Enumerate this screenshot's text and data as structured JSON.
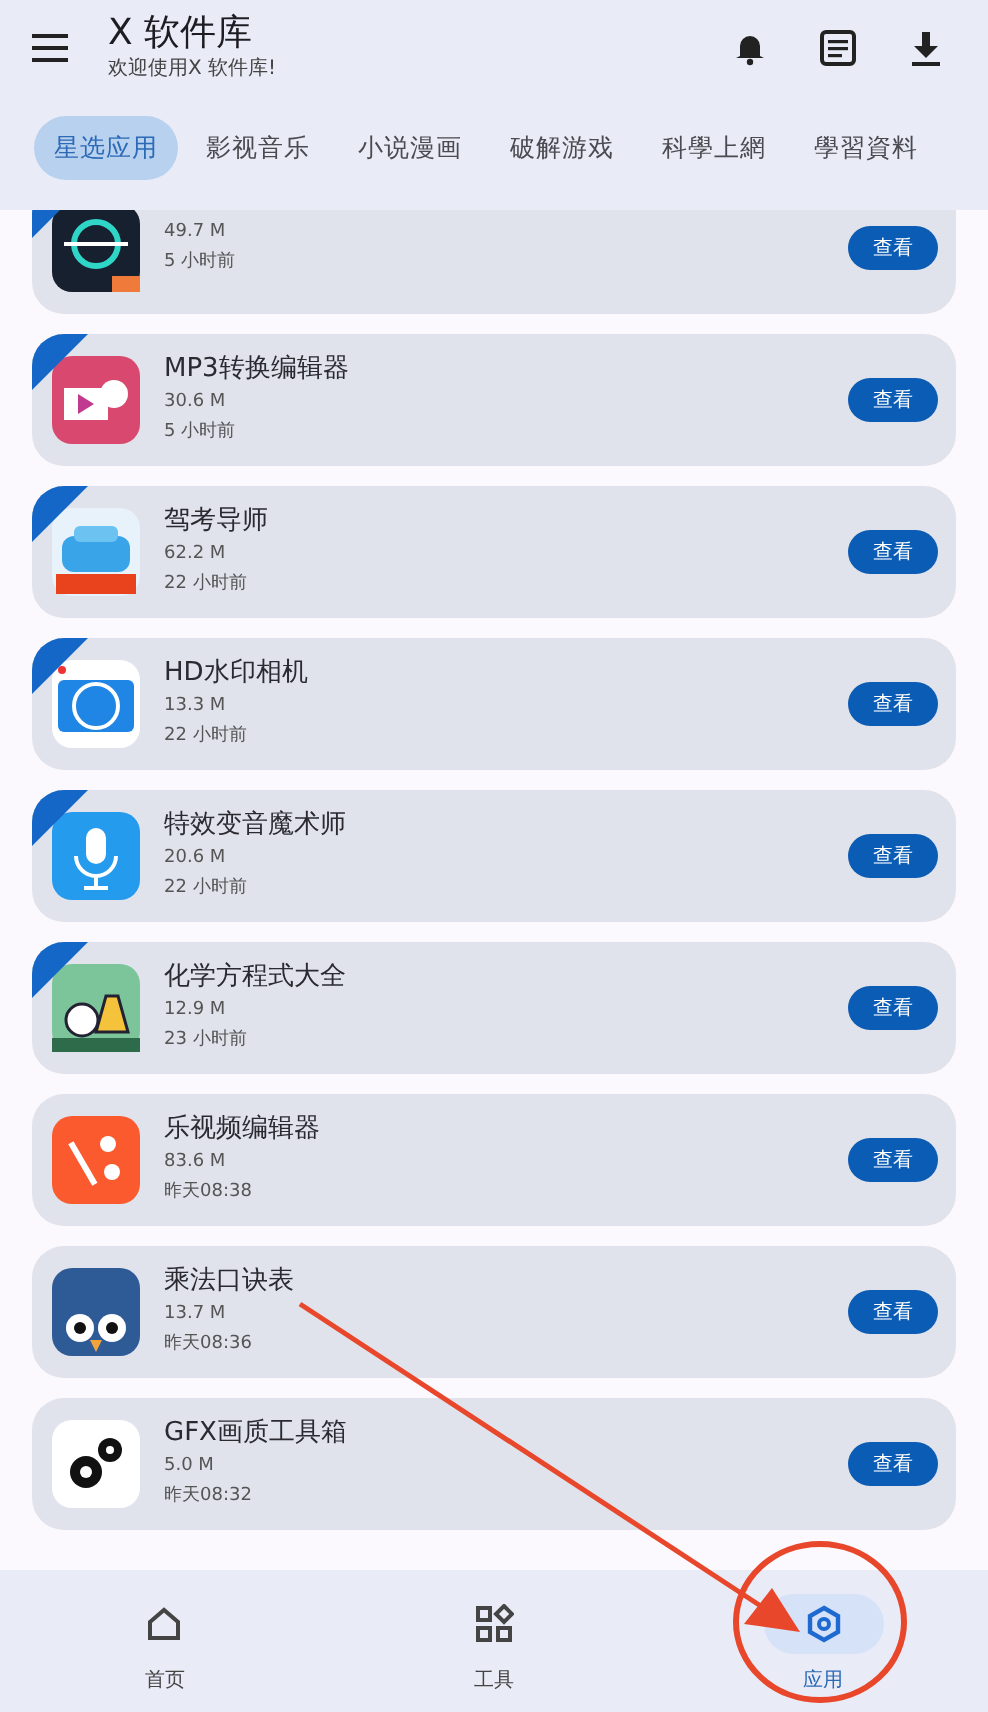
{
  "header": {
    "title": "X 软件库",
    "subtitle": "欢迎使用X 软件库!"
  },
  "tabs": [
    {
      "label": "星选应用",
      "selected": true
    },
    {
      "label": "影视音乐",
      "selected": false
    },
    {
      "label": "小说漫画",
      "selected": false
    },
    {
      "label": "破解游戏",
      "selected": false
    },
    {
      "label": "科學上網",
      "selected": false
    },
    {
      "label": "學習資料",
      "selected": false
    }
  ],
  "apps": [
    {
      "kind": "crosshair",
      "size": "49.7 M",
      "time": "5 小时前",
      "ribbon": true,
      "button": "查看"
    },
    {
      "kind": "media",
      "name": "MP3转换编辑器",
      "size": "30.6 M",
      "time": "5 小时前",
      "ribbon": true,
      "button": "查看"
    },
    {
      "kind": "car",
      "name": "驾考导师",
      "size": "62.2 M",
      "time": "22 小时前",
      "ribbon": true,
      "button": "查看"
    },
    {
      "kind": "camera",
      "name": "HD水印相机",
      "size": "13.3 M",
      "time": "22 小时前",
      "ribbon": true,
      "button": "查看"
    },
    {
      "kind": "mic",
      "name": "特效变音魔术师",
      "size": "20.6 M",
      "time": "22 小时前",
      "ribbon": true,
      "button": "查看"
    },
    {
      "kind": "flask",
      "name": "化学方程式大全",
      "size": "12.9 M",
      "time": "23 小时前",
      "ribbon": true,
      "button": "查看"
    },
    {
      "kind": "wand",
      "name": "乐视频编辑器",
      "size": "83.6 M",
      "time": "昨天08:38",
      "ribbon": false,
      "button": "查看"
    },
    {
      "kind": "owl",
      "name": "乘法口诀表",
      "size": "13.7 M",
      "time": "昨天08:36",
      "ribbon": false,
      "button": "查看"
    },
    {
      "kind": "gears",
      "name": "GFX画质工具箱",
      "size": "5.0 M",
      "time": "昨天08:32",
      "ribbon": false,
      "button": "查看"
    }
  ],
  "bottom_nav": [
    {
      "kind": "home",
      "label": "首页",
      "selected": false
    },
    {
      "kind": "tools",
      "label": "工具",
      "selected": false
    },
    {
      "kind": "apps",
      "label": "应用",
      "selected": true
    }
  ]
}
